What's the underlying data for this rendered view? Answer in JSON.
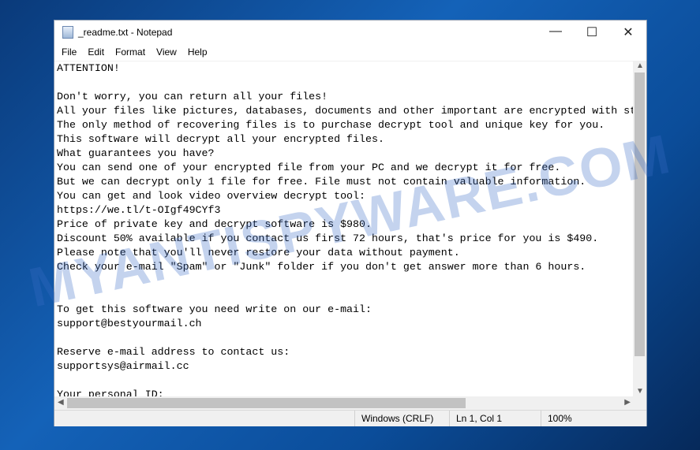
{
  "watermark": "MYANTISPYWARE.COM",
  "window": {
    "title": "_readme.txt - Notepad",
    "controls": {
      "minimize": "—",
      "maximize": "☐",
      "close": "✕"
    }
  },
  "menu": [
    "File",
    "Edit",
    "Format",
    "View",
    "Help"
  ],
  "content": "ATTENTION!\n\nDon't worry, you can return all your files!\nAll your files like pictures, databases, documents and other important are encrypted with strongest encryption and unique key.\nThe only method of recovering files is to purchase decrypt tool and unique key for you.\nThis software will decrypt all your encrypted files.\nWhat guarantees you have?\nYou can send one of your encrypted file from your PC and we decrypt it for free.\nBut we can decrypt only 1 file for free. File must not contain valuable information.\nYou can get and look video overview decrypt tool:\nhttps://we.tl/t-OIgf49CYf3\nPrice of private key and decrypt software is $980.\nDiscount 50% available if you contact us first 72 hours, that's price for you is $490.\nPlease note that you'll never restore your data without payment.\nCheck your e-mail \"Spam\" or \"Junk\" folder if you don't get answer more than 6 hours.\n\n\nTo get this software you need write on our e-mail:\nsupport@bestyourmail.ch\n\nReserve e-mail address to contact us:\nsupportsys@airmail.cc\n\nYour personal ID:",
  "status": {
    "line_ending": "Windows (CRLF)",
    "position": "Ln 1, Col 1",
    "zoom": "100%"
  }
}
